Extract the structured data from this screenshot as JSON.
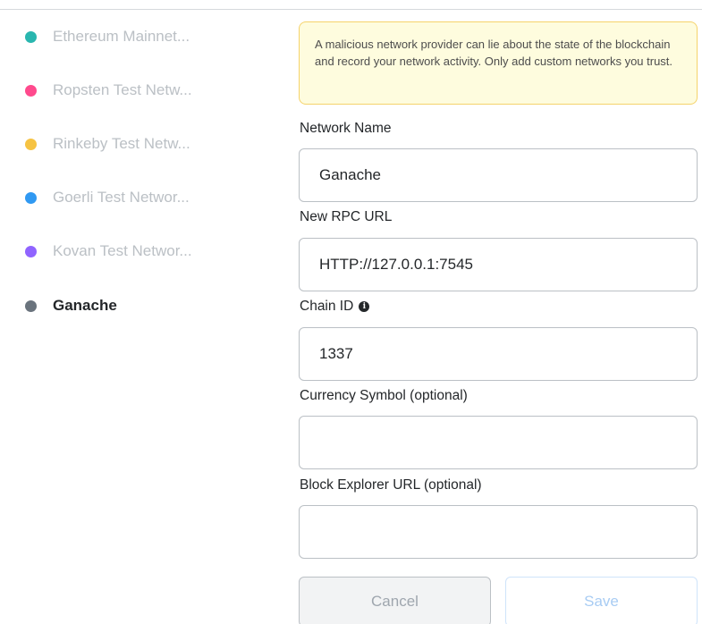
{
  "networks": [
    {
      "label": "Ethereum Mainnet...",
      "color": "#29b6af"
    },
    {
      "label": "Ropsten Test Netw...",
      "color": "#ff4a8d"
    },
    {
      "label": "Rinkeby Test Netw...",
      "color": "#f6c343"
    },
    {
      "label": "Goerli Test Networ...",
      "color": "#3099f2"
    },
    {
      "label": "Kovan Test Networ...",
      "color": "#9064ff"
    },
    {
      "label": "Ganache",
      "color": "#6a737d"
    }
  ],
  "warning": "A malicious network provider can lie about the state of the blockchain and record your network activity. Only add custom networks you trust.",
  "fields": {
    "network_name": {
      "label": "Network Name",
      "value": "Ganache"
    },
    "rpc_url": {
      "label": "New RPC URL",
      "value": "HTTP://127.0.0.1:7545"
    },
    "chain_id": {
      "label": "Chain ID",
      "value": "1337",
      "info_icon": "info-icon"
    },
    "currency_symbol": {
      "label": "Currency Symbol (optional)",
      "value": ""
    },
    "block_explorer": {
      "label": "Block Explorer URL (optional)",
      "value": ""
    }
  },
  "buttons": {
    "cancel": "Cancel",
    "save": "Save"
  },
  "colors": {
    "warning_bg": "#fefcde",
    "warning_border": "#f5d36b",
    "save_text": "#a8ccf3"
  }
}
